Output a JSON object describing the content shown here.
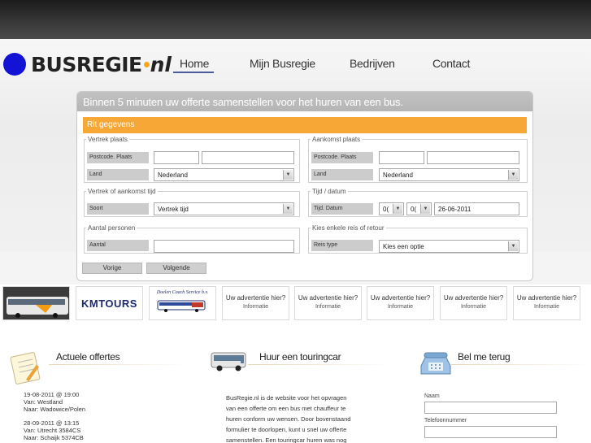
{
  "brand": {
    "name": "BUSREGIE",
    "suffix": "nl"
  },
  "nav": {
    "items": [
      "Home",
      "Mijn Busregie",
      "Bedrijven",
      "Contact"
    ]
  },
  "form": {
    "title": "Binnen 5 minuten uw offerte samenstellen voor het huren van een bus.",
    "section": "Rit gegevens",
    "vertrek_plaats": {
      "legend": "Vertrek plaats",
      "postcode_label": "Postcode. Plaats",
      "land_label": "Land",
      "land_value": "Nederland"
    },
    "aankomst_plaats": {
      "legend": "Aankomst plaats",
      "postcode_label": "Postcode. Plaats",
      "land_label": "Land",
      "land_value": "Nederland"
    },
    "vertrek_tijd": {
      "legend": "Vertrek of aankomst tijd",
      "soort_label": "Soort",
      "soort_value": "Vertrek tijd"
    },
    "tijd_datum": {
      "legend": "Tijd / datum",
      "label": "Tijd. Datum",
      "hour": "0(",
      "minute": "0(",
      "date": "26-06-2011"
    },
    "personen": {
      "legend": "Aantal personen",
      "label": "Aantal"
    },
    "reis": {
      "legend": "Kies enkele reis of retour",
      "label": "Reis type",
      "value": "Kies een optie"
    },
    "buttons": {
      "prev": "Vorige",
      "next": "Volgende"
    }
  },
  "ads": {
    "kmt": "KMTOURS",
    "doelen": "Doelen Coach Service b.v.",
    "placeholder_title": "Uw advertentie hier?",
    "placeholder_info": "Informatie"
  },
  "sections": {
    "offertes": {
      "title": "Actuele offertes",
      "items": [
        {
          "date": "19-08-2011 @ 19:00",
          "van": "Van: Westland",
          "naar": "Naar: Wadowice/Polen"
        },
        {
          "date": "28-09-2011 @ 13:15",
          "van": "Van: Utrecht 3584CS",
          "naar": "Naar: Schaijk 5374CB"
        }
      ]
    },
    "touringcar": {
      "title": "Huur een touringcar",
      "lines": [
        "BusRegie.nl is de website voor het opvragen",
        "van een offerte om een bus met chauffeur te",
        "huren conform uw wensen. Door bovenstaand",
        "formulier te doorlopen, kunt u snel uw offerte",
        "samenstellen. Een touringcar huren was nog"
      ]
    },
    "belmeterug": {
      "title": "Bel me terug",
      "name_label": "Naam",
      "phone_label": "Telefoonnummer"
    }
  }
}
